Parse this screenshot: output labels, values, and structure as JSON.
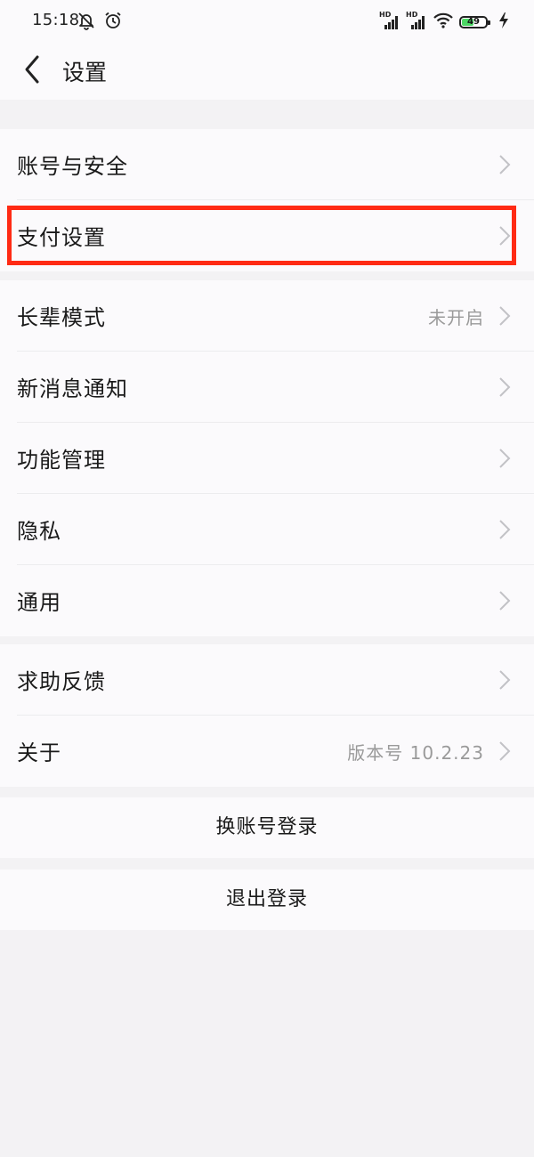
{
  "status_bar": {
    "time": "15:18",
    "signal_label": "HD",
    "battery_level": "49",
    "battery_fraction": 0.49,
    "icons": [
      "mute-bell-icon",
      "alarm-clock-icon",
      "signal-hd-icon",
      "signal-hd-icon",
      "wifi-icon",
      "battery-icon",
      "charging-bolt-icon"
    ],
    "battery_color": "#4cd964"
  },
  "header": {
    "title": "设置",
    "back_icon": "chevron-left-icon"
  },
  "groups": [
    {
      "items": [
        {
          "label": "账号与安全",
          "value": ""
        },
        {
          "label": "支付设置",
          "value": ""
        }
      ]
    },
    {
      "items": [
        {
          "label": "长辈模式",
          "value": "未开启"
        },
        {
          "label": "新消息通知",
          "value": ""
        },
        {
          "label": "功能管理",
          "value": ""
        },
        {
          "label": "隐私",
          "value": ""
        },
        {
          "label": "通用",
          "value": ""
        }
      ]
    },
    {
      "items": [
        {
          "label": "求助反馈",
          "value": ""
        },
        {
          "label": "关于",
          "value": "版本号 10.2.23"
        }
      ]
    }
  ],
  "actions": {
    "switch_account": "换账号登录",
    "logout": "退出登录"
  },
  "highlight_color": "#ff2a14"
}
